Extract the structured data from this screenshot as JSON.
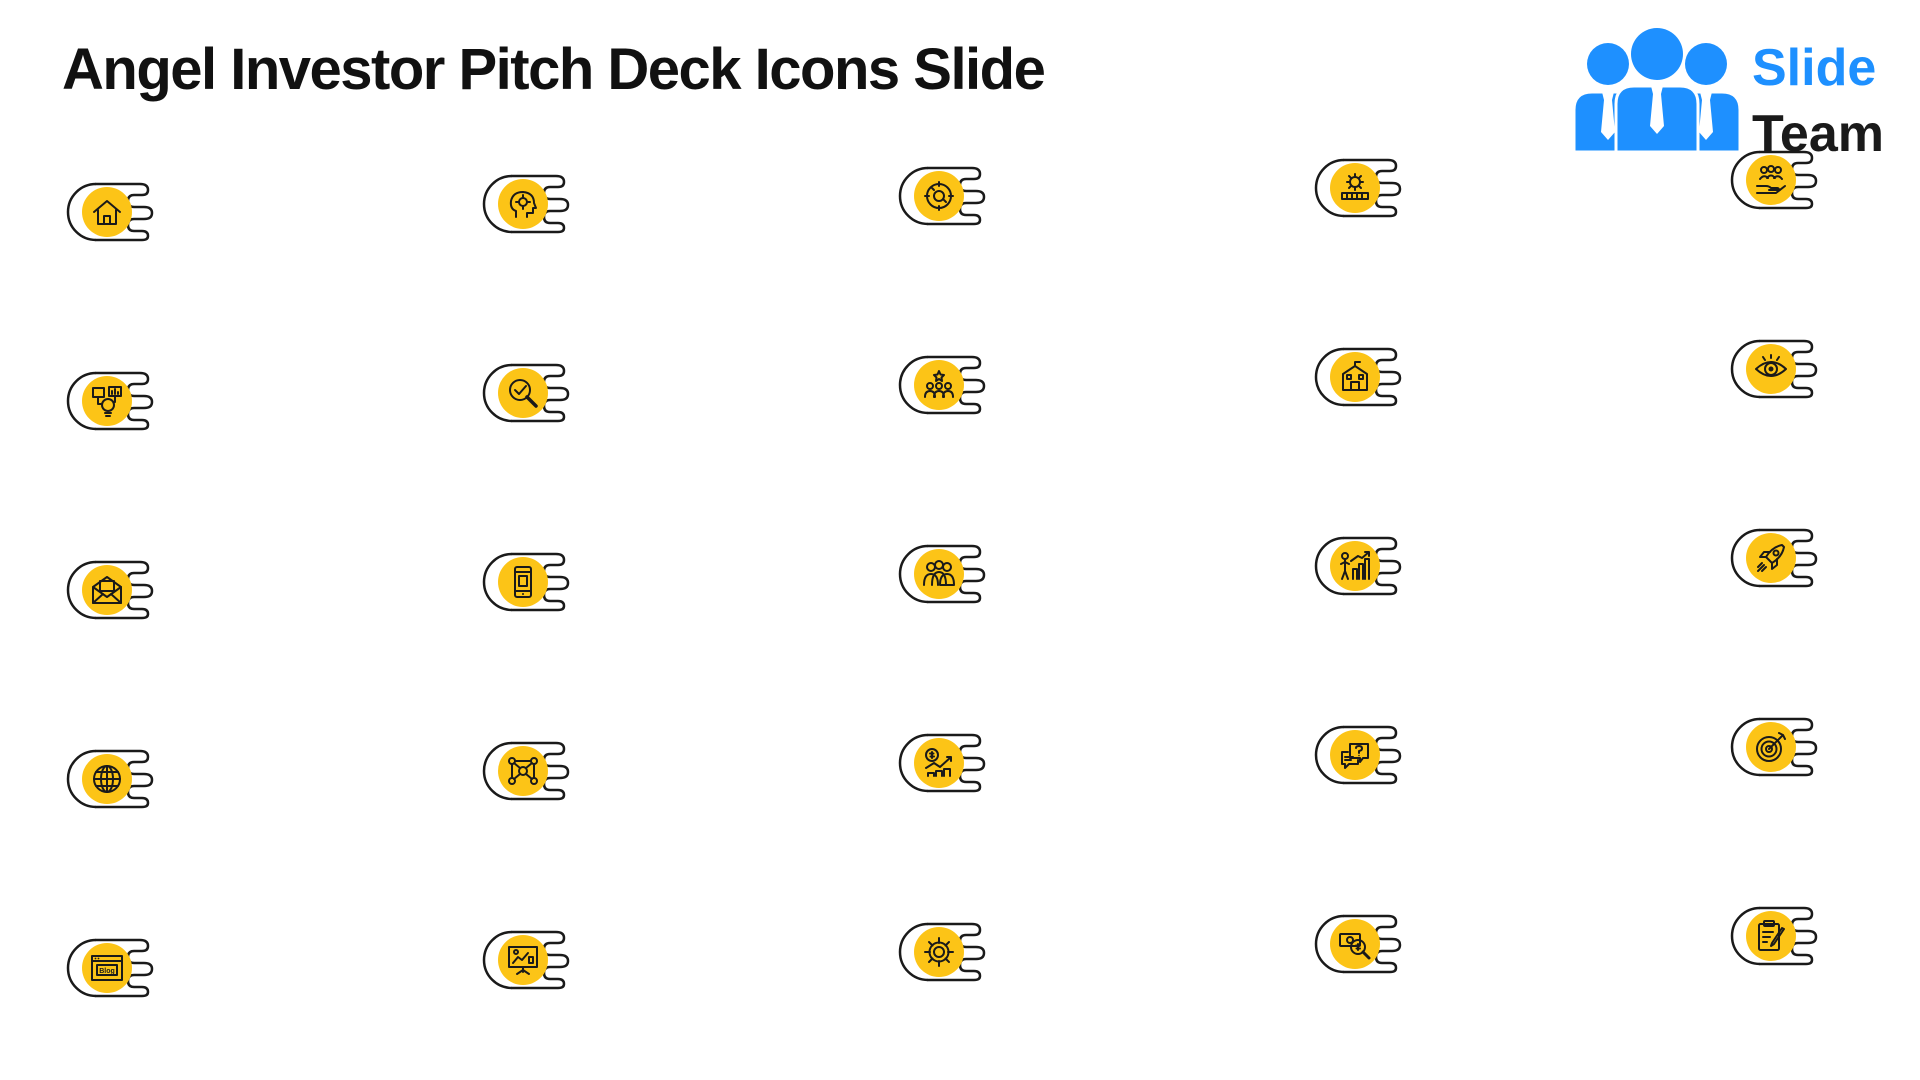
{
  "slide": {
    "title": "Angel Investor Pitch Deck Icons Slide"
  },
  "brand": {
    "word1": "Slide",
    "word2": "Team",
    "color": "#1e90ff"
  },
  "palette": {
    "icon_fill": "#fcc417",
    "outline": "#1a1a1a"
  },
  "icons": [
    "home-icon",
    "brain-gear-icon",
    "target-cycle-icon",
    "factory-gear-icon",
    "team-hand-icon",
    "idea-chart-icon",
    "magnifier-check-icon",
    "audience-icon",
    "building-icon",
    "eye-icon",
    "mail-icon",
    "mobile-phone-icon",
    "group-icon",
    "growth-chart-icon",
    "rocket-icon",
    "globe-icon",
    "network-nodes-icon",
    "money-growth-icon",
    "chat-question-icon",
    "target-arrow-icon",
    "blog-icon",
    "presentation-board-icon",
    "settings-gear-icon",
    "money-search-icon",
    "clipboard-edit-icon"
  ]
}
